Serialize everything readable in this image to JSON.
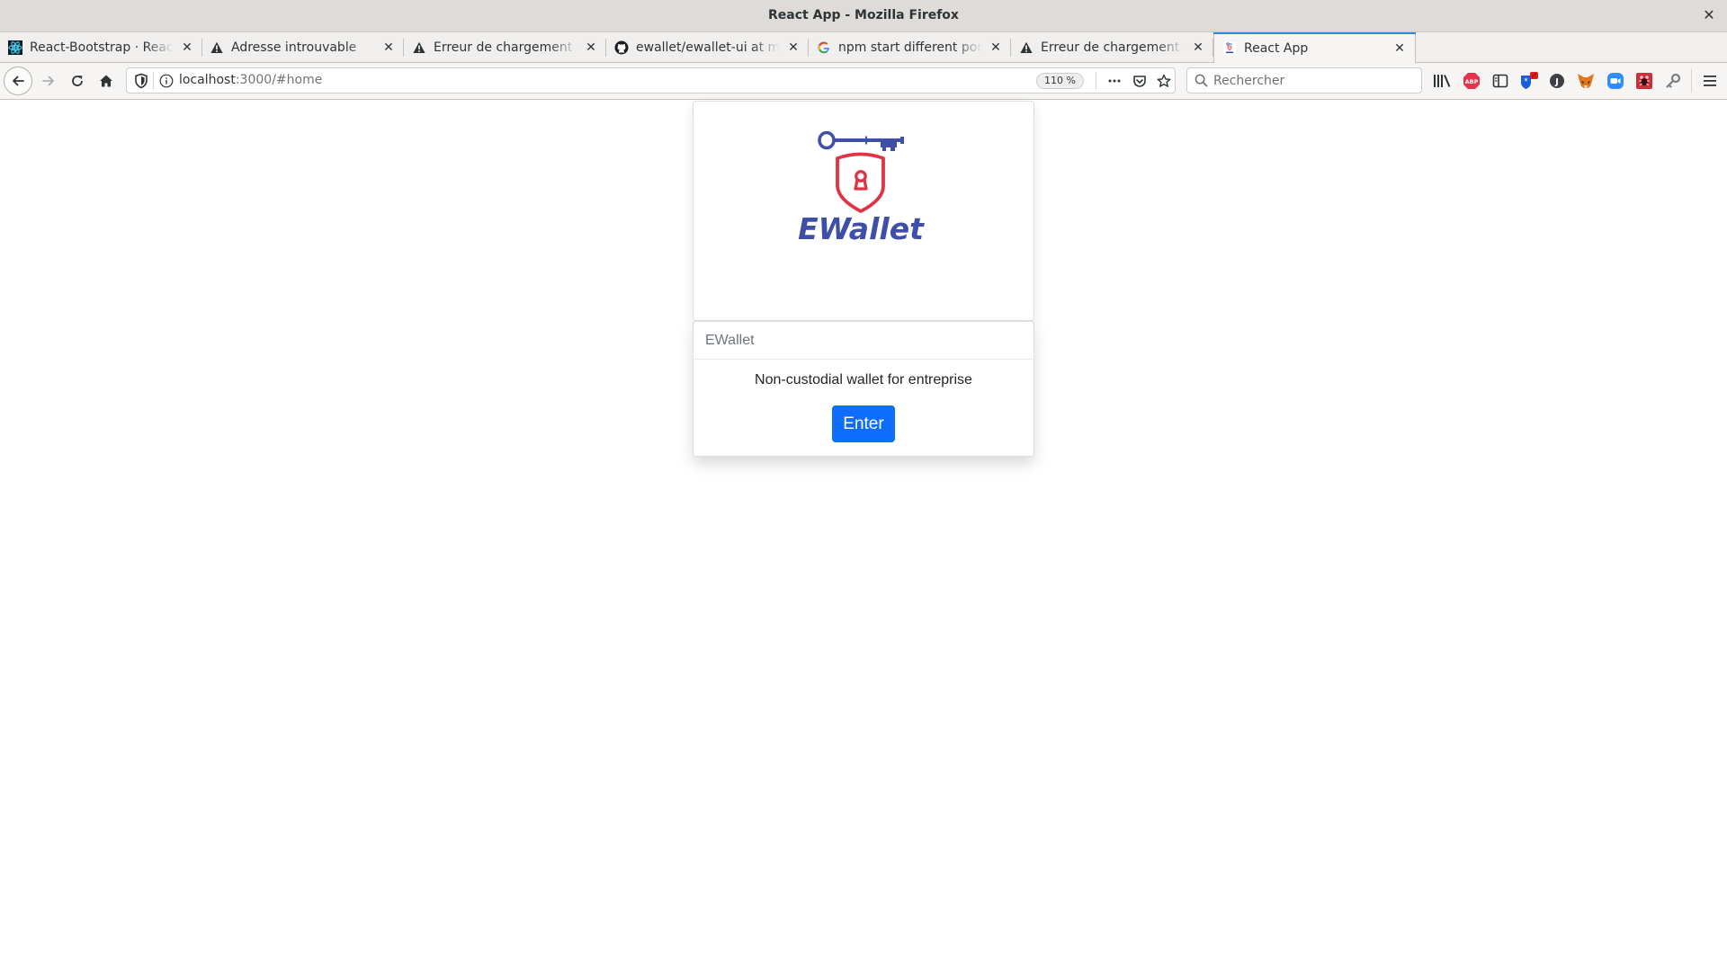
{
  "window": {
    "title": "React App - Mozilla Firefox"
  },
  "tabs": [
    {
      "label": "React-Bootstrap · React-Bootstrap Documentation",
      "icon": "react-bootstrap-favicon",
      "active": false
    },
    {
      "label": "Adresse introuvable",
      "icon": "warning-icon",
      "active": false
    },
    {
      "label": "Erreur de chargement de la page",
      "icon": "warning-icon",
      "active": false
    },
    {
      "label": "ewallet/ewallet-ui at main",
      "icon": "github-icon",
      "active": false
    },
    {
      "label": "npm start different port - Recherche Google",
      "icon": "google-icon",
      "active": false
    },
    {
      "label": "Erreur de chargement de la page",
      "icon": "warning-icon",
      "active": false
    },
    {
      "label": "React App",
      "icon": "ewallet-favicon",
      "active": true
    }
  ],
  "navbar": {
    "url_host": "localhost",
    "url_path": ":3000/#home",
    "zoom_level": "110 %",
    "search_placeholder": "Rechercher"
  },
  "toolbar_icons": [
    "library-icon",
    "adblock-plus-icon",
    "sidebar-icon",
    "bitwarden-icon",
    "j-extension-icon",
    "metamask-icon",
    "zoom-icon",
    "bug-extension-icon",
    "key-icon",
    "menu-icon"
  ],
  "brand": {
    "logo_text": "EWallet",
    "primary_color": "#3f4fa8",
    "accent_color": "#e03444"
  },
  "card": {
    "header": "EWallet",
    "text": "Non-custodial wallet for entreprise",
    "button_label": "Enter",
    "button_color": "#0d6efd"
  }
}
